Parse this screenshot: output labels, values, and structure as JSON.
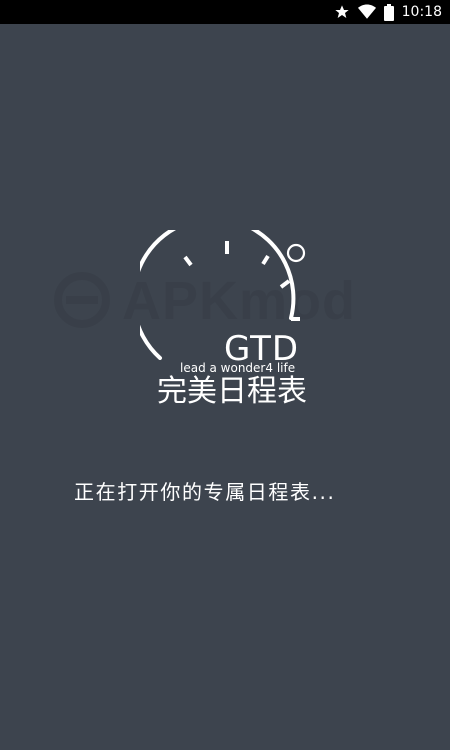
{
  "status_bar": {
    "time": "10:18",
    "icons": [
      "star-icon",
      "wifi-icon",
      "battery-icon"
    ]
  },
  "logo": {
    "title": "GTD",
    "tagline": "lead a wonder4 life",
    "name": "完美日程表"
  },
  "watermark": {
    "text": "APKmod"
  },
  "loading": {
    "message": "正在打开你的专属日程表..."
  },
  "colors": {
    "background": "#3d444e",
    "status_bar": "#000000",
    "foreground": "#ffffff"
  }
}
